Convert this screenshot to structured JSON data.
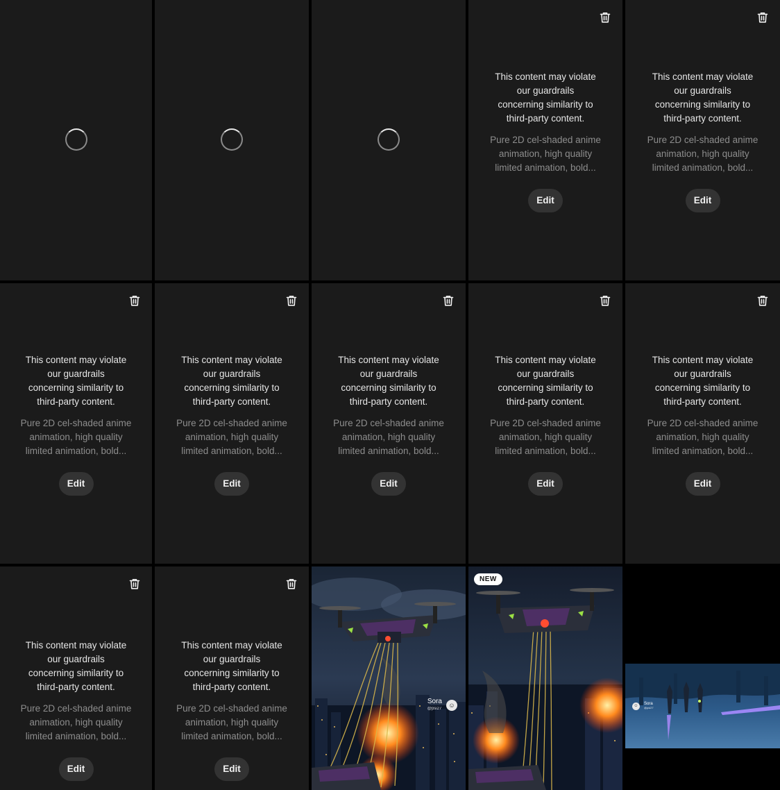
{
  "warning_text": "This content may violate our guardrails concerning similarity to third-party content.",
  "prompt_text": "Pure 2D cel-shaded anime animation, high quality limited animation, bold...",
  "edit_label": "Edit",
  "new_badge": "NEW",
  "watermark": {
    "brand": "Sora",
    "handle": "@psi27"
  },
  "icons": {
    "delete": "trash-icon",
    "loading": "spinner-icon"
  },
  "colors": {
    "background": "#000000",
    "tile": "#1b1b1b",
    "button": "#333333",
    "warning": "#e6e6e6",
    "prompt": "#8d8d8d"
  },
  "tiles": [
    {
      "kind": "loading"
    },
    {
      "kind": "loading"
    },
    {
      "kind": "loading"
    },
    {
      "kind": "blocked"
    },
    {
      "kind": "blocked"
    },
    {
      "kind": "blocked"
    },
    {
      "kind": "blocked"
    },
    {
      "kind": "blocked"
    },
    {
      "kind": "blocked"
    },
    {
      "kind": "blocked"
    },
    {
      "kind": "blocked"
    },
    {
      "kind": "blocked"
    },
    {
      "kind": "image",
      "scene": "aircraft-city-fire",
      "watermark": true
    },
    {
      "kind": "image",
      "scene": "aircraft-city-fire",
      "badge": true
    },
    {
      "kind": "image",
      "scene": "forest-night-landscape",
      "watermark": true
    }
  ]
}
